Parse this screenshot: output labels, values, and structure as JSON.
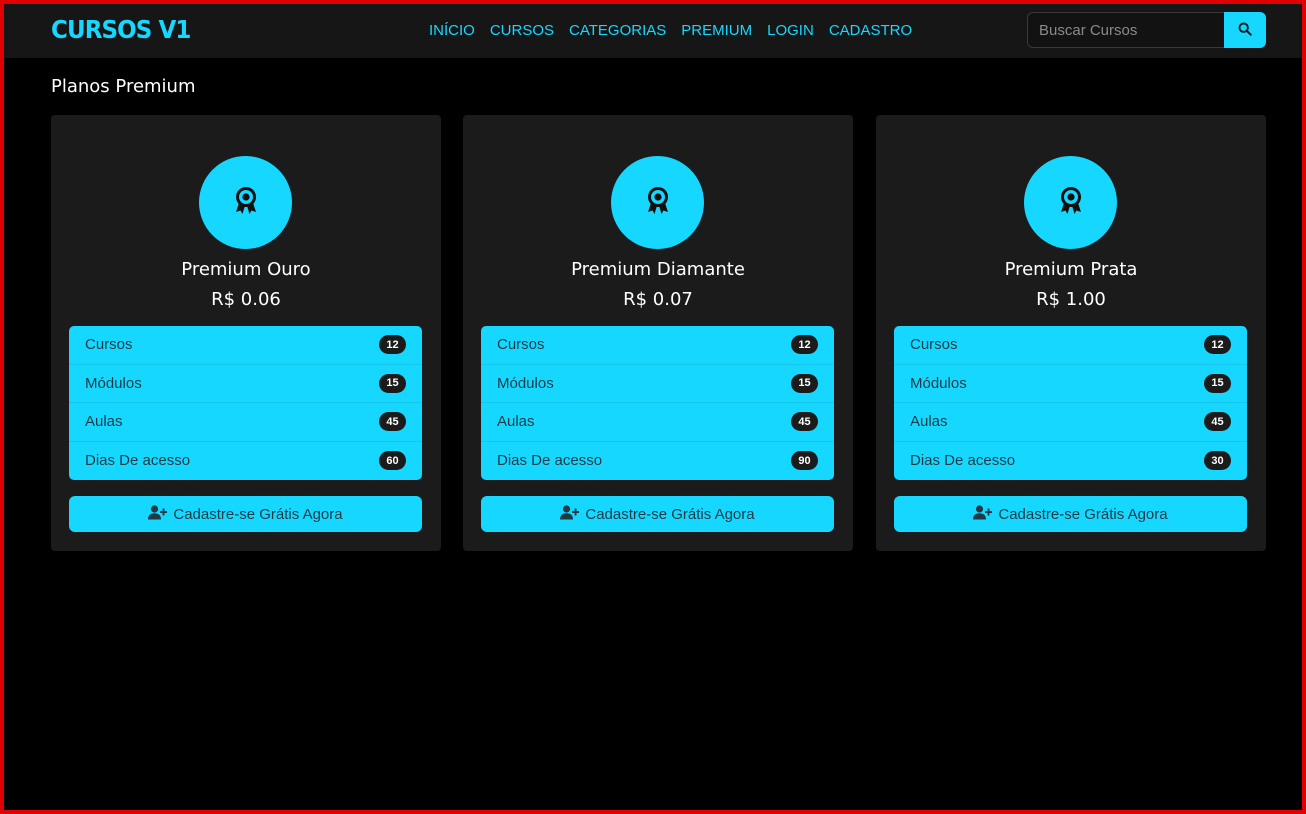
{
  "navbar": {
    "brand": "CURSOS V1",
    "links": [
      "INÍCIO",
      "CURSOS",
      "CATEGORIAS",
      "PREMIUM",
      "LOGIN",
      "CADASTRO"
    ],
    "search_placeholder": "Buscar Cursos",
    "search_icon": "search-icon"
  },
  "page": {
    "title": "Planos Premium"
  },
  "plans": [
    {
      "name": "Premium Ouro",
      "price": "R$ 0.06",
      "icon": "award-icon",
      "features": [
        {
          "label": "Cursos",
          "value": "12"
        },
        {
          "label": "Módulos",
          "value": "15"
        },
        {
          "label": "Aulas",
          "value": "45"
        },
        {
          "label": "Dias De acesso",
          "value": "60"
        }
      ],
      "cta_label": "Cadastre-se Grátis Agora"
    },
    {
      "name": "Premium Diamante",
      "price": "R$ 0.07",
      "icon": "award-icon",
      "features": [
        {
          "label": "Cursos",
          "value": "12"
        },
        {
          "label": "Módulos",
          "value": "15"
        },
        {
          "label": "Aulas",
          "value": "45"
        },
        {
          "label": "Dias De acesso",
          "value": "90"
        }
      ],
      "cta_label": "Cadastre-se Grátis Agora"
    },
    {
      "name": "Premium Prata",
      "price": "R$ 1.00",
      "icon": "award-icon",
      "features": [
        {
          "label": "Cursos",
          "value": "12"
        },
        {
          "label": "Módulos",
          "value": "15"
        },
        {
          "label": "Aulas",
          "value": "45"
        },
        {
          "label": "Dias De acesso",
          "value": "30"
        }
      ],
      "cta_label": "Cadastre-se Grátis Agora"
    }
  ],
  "colors": {
    "accent": "#16d7ff",
    "background": "#000000",
    "card": "#1b1b1b",
    "navbar": "#161616",
    "frame_border": "#e00000"
  }
}
